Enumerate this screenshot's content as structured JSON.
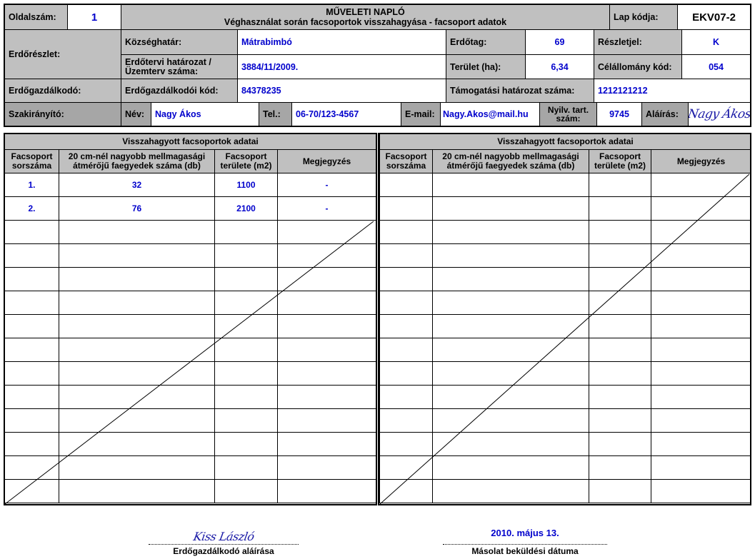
{
  "header": {
    "oldalszam_label": "Oldalszám:",
    "oldalszam_value": "1",
    "title": "MŰVELETI NAPLÓ",
    "subtitle": "Véghasználat során facsoportok visszahagyása - facsoport adatok",
    "lapkod_label": "Lap kódja:",
    "lapkod_value": "EKV07-2"
  },
  "erdoreszlet": {
    "label": "Erdőrészlet:",
    "kozseghatar_label": "Községhatár:",
    "kozseghatar_value": "Mátrabimbó",
    "erdotag_label": "Erdőtag:",
    "erdotag_value": "69",
    "reszletjel_label": "Részletjel:",
    "reszletjel_value": "K",
    "hatarozat_label_1": "Erdőtervi határozat /",
    "hatarozat_label_2": "Üzemterv száma:",
    "hatarozat_value": "3884/11/2009.",
    "terulet_label": "Terület (ha):",
    "terulet_value": "6,34",
    "celallomany_label": "Célállomány kód:",
    "celallomany_value": "054"
  },
  "erdogazdalkodo": {
    "label": "Erdőgazdálkodó:",
    "kod_label": "Erdőgazdálkodói kód:",
    "kod_value": "84378235",
    "tamogatasi_label": "Támogatási határozat száma:",
    "tamogatasi_value": "1212121212"
  },
  "szakiranyito": {
    "label": "Szakirányító:",
    "nev_label": "Név:",
    "nev_value": "Nagy Ákos",
    "tel_label": "Tel.:",
    "tel_value": "06-70/123-4567",
    "email_label": "E-mail:",
    "email_value": "Nagy.Akos@mail.hu",
    "nyilv_label_1": "Nyilv. tart.",
    "nyilv_label_2": "szám:",
    "nyilv_value": "9745",
    "alairas_label": "Aláírás:",
    "alairas_signature": "Nagy Ákos"
  },
  "table": {
    "section_title": "Visszahagyott facsoportok adatai",
    "col_sorszam_1": "Facsoport",
    "col_sorszam_2": "sorszáma",
    "col_db_1": "20 cm-nél nagyobb mellmagasági",
    "col_db_2": "átmérőjű faegyedek száma (db)",
    "col_terulet_1": "Facsoport",
    "col_terulet_2": "területe (m2)",
    "col_megjegyzes": "Megjegyzés",
    "left_rows": [
      {
        "sorszam": "1.",
        "db": "32",
        "terulet": "1100",
        "megjegyzes": "-"
      },
      {
        "sorszam": "2.",
        "db": "76",
        "terulet": "2100",
        "megjegyzes": "-"
      }
    ]
  },
  "footer": {
    "signature": "Kiss László",
    "signature_caption": "Erdőgazdálkodó aláírása",
    "date_value": "2010. május 13.",
    "date_caption": "Másolat beküldési dátuma"
  }
}
